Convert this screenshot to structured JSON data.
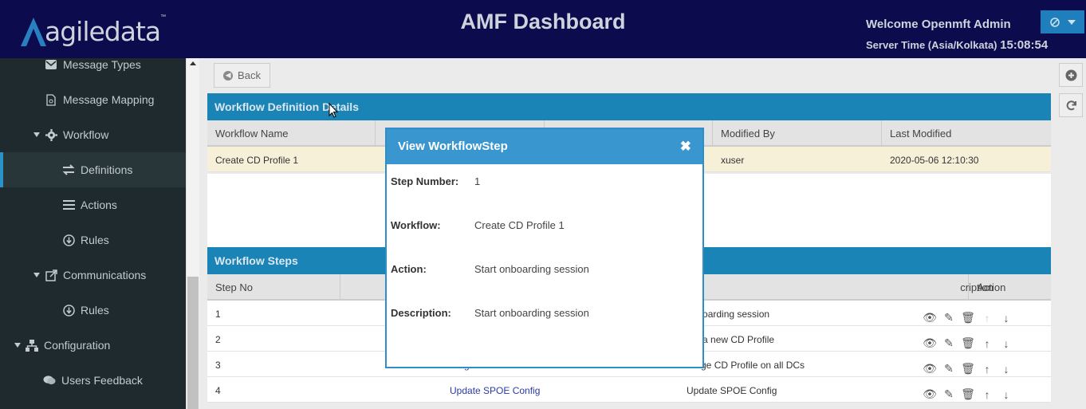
{
  "header": {
    "logo_text": "agiledata",
    "logo_tm": "™",
    "title": "AMF Dashboard",
    "welcome": "Welcome Openmft Admin",
    "server_time_label": "Server Time (Asia/Kolkata)",
    "server_time": "15:08:54"
  },
  "sidebar": {
    "items": [
      {
        "label": "Message Types",
        "icon": "envelope-icon"
      },
      {
        "label": "Message Mapping",
        "icon": "document-icon"
      },
      {
        "label": "Workflow",
        "icon": "gear-icon"
      },
      {
        "label": "Definitions",
        "icon": "arrows-icon"
      },
      {
        "label": "Actions",
        "icon": "list-icon"
      },
      {
        "label": "Rules",
        "icon": "circle-arrow-icon"
      },
      {
        "label": "Communications",
        "icon": "share-icon"
      },
      {
        "label": "Rules",
        "icon": "circle-arrow-icon"
      },
      {
        "label": "Configuration",
        "icon": "sitemap-icon"
      },
      {
        "label": "Users Feedback",
        "icon": "comments-icon"
      }
    ]
  },
  "main": {
    "back_label": "Back",
    "definition_panel": {
      "title": "Workflow Definition Details",
      "columns": [
        "Workflow Name",
        "",
        "",
        "Modified By",
        "Last Modified"
      ],
      "rows": [
        [
          "Create CD Profile 1",
          "",
          "",
          "xuser",
          "2020-05-06 12:10:30"
        ]
      ]
    },
    "steps_panel": {
      "title": "Workflow Steps",
      "columns": [
        "Step No",
        "",
        "cription",
        "Action"
      ],
      "rows": [
        {
          "step": "1",
          "name": "",
          "desc": "onboarding session"
        },
        {
          "step": "2",
          "name": "",
          "desc": "ate a new CD Profile"
        },
        {
          "step": "3",
          "name": "Stage CD Profile on all DCs",
          "desc": "Stage CD Profile on all DCs"
        },
        {
          "step": "4",
          "name": "Update SPOE Config",
          "desc": "Update SPOE Config"
        }
      ]
    }
  },
  "modal": {
    "title": "View WorkflowStep",
    "close": "✖",
    "fields": [
      {
        "label": "Step Number:",
        "value": "1"
      },
      {
        "label": "Workflow:",
        "value": "Create CD Profile 1"
      },
      {
        "label": "Action:",
        "value": "Start onboarding session"
      },
      {
        "label": "Description:",
        "value": "Start onboarding session"
      }
    ]
  },
  "colors": {
    "header_bg": "#0b0b4e",
    "sidebar_bg": "#1e2a2e",
    "panel_head": "#1b84b7",
    "modal_head": "#3a96cf",
    "row_highlight": "#f7f0d8"
  }
}
